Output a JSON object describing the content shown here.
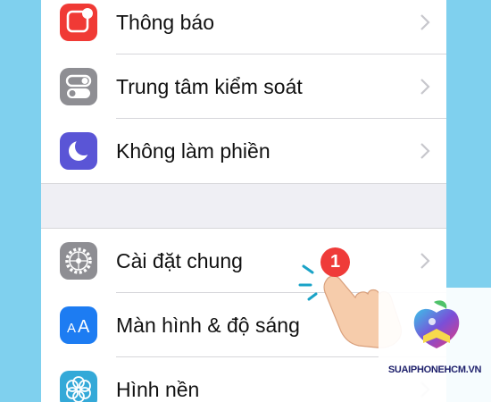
{
  "settings_groups": [
    {
      "items": [
        {
          "label": "Thông báo",
          "icon": "notifications-icon",
          "icon_color": "#f03a35"
        },
        {
          "label": "Trung tâm kiểm soát",
          "icon": "control-center-icon",
          "icon_color": "#8e8e93"
        },
        {
          "label": "Không làm phiền",
          "icon": "moon-icon",
          "icon_color": "#5a55d6"
        }
      ]
    },
    {
      "items": [
        {
          "label": "Cài đặt chung",
          "icon": "gear-icon",
          "icon_color": "#8e8e93"
        },
        {
          "label": "Màn hình & độ sáng",
          "icon": "display-brightness-icon",
          "icon_color": "#1d7cf2"
        },
        {
          "label": "Hình nền",
          "icon": "wallpaper-flower-icon",
          "icon_color": "#34a9d8"
        }
      ]
    }
  ],
  "step_badge": "1",
  "watermark": {
    "text": "SUAIPHONEHCM.VN"
  },
  "colors": {
    "background": "#7fd0ee",
    "list_background": "#efeff4",
    "badge": "#ef3b39",
    "chevron": "#c7c7cc"
  }
}
